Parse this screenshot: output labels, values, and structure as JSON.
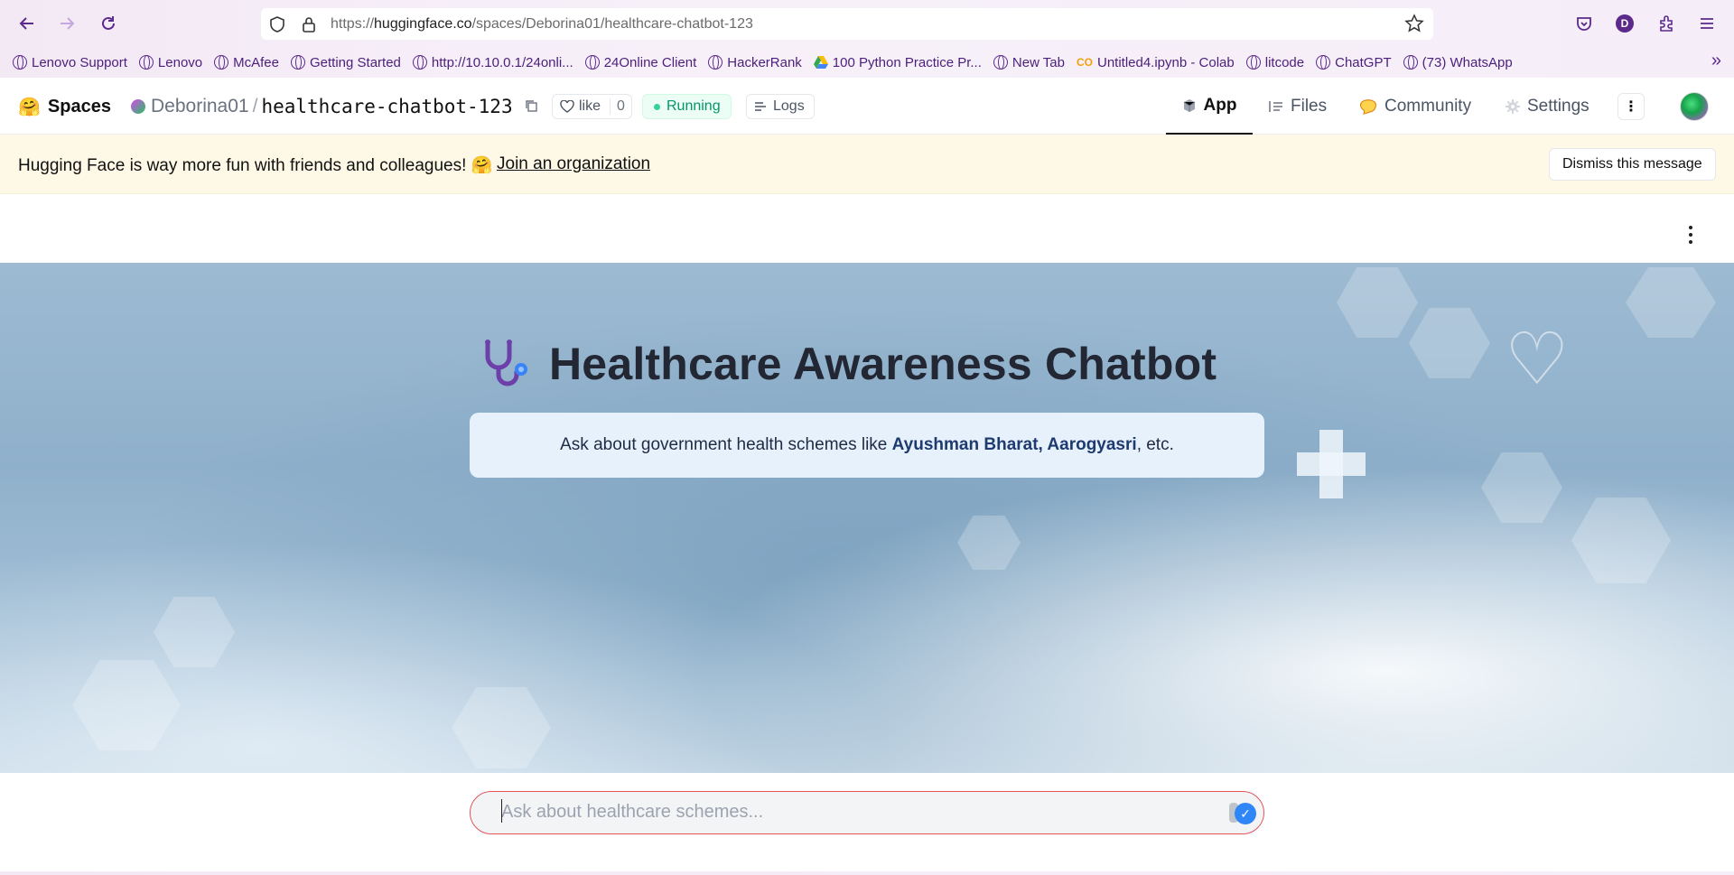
{
  "browser": {
    "url_prefix": "https://",
    "url_host": "huggingface.co",
    "url_path": "/spaces/Deborina01/healthcare-chatbot-123",
    "profile_initial": "D",
    "bookmarks": [
      {
        "label": "Lenovo Support",
        "icon": "globe-icon"
      },
      {
        "label": "Lenovo",
        "icon": "globe-icon"
      },
      {
        "label": "McAfee",
        "icon": "globe-icon"
      },
      {
        "label": "Getting Started",
        "icon": "globe-icon"
      },
      {
        "label": "http://10.10.0.1/24onli...",
        "icon": "globe-icon"
      },
      {
        "label": "24Online Client",
        "icon": "globe-icon"
      },
      {
        "label": "HackerRank",
        "icon": "globe-icon"
      },
      {
        "label": "100 Python Practice Pr...",
        "icon": "drive-icon"
      },
      {
        "label": "New Tab",
        "icon": "globe-icon"
      },
      {
        "label": "Untitled4.ipynb - Colab",
        "icon": "colab-icon"
      },
      {
        "label": "litcode",
        "icon": "globe-icon"
      },
      {
        "label": "ChatGPT",
        "icon": "globe-icon"
      },
      {
        "label": "(73) WhatsApp",
        "icon": "globe-icon"
      }
    ]
  },
  "hf": {
    "spaces_label": "Spaces",
    "owner": "Deborina01",
    "separator": "/",
    "repo": "healthcare-chatbot-123",
    "like_label": "like",
    "like_count": "0",
    "status": "Running",
    "logs_label": "Logs",
    "tabs": [
      {
        "label": "App",
        "icon": "cube-icon",
        "active": true
      },
      {
        "label": "Files",
        "icon": "files-icon",
        "active": false
      },
      {
        "label": "Community",
        "icon": "community-icon",
        "active": false
      },
      {
        "label": "Settings",
        "icon": "gear-icon",
        "active": false
      }
    ]
  },
  "banner": {
    "message": "Hugging Face is way more fun with friends and colleagues! 🤗",
    "link": "Join an organization",
    "dismiss": "Dismiss this message"
  },
  "app": {
    "title": "Healthcare Awareness Chatbot",
    "subtitle_pre": "Ask about government health schemes like ",
    "scheme_1": "Ayushman Bharat",
    "comma": ", ",
    "scheme_2": "Aarogyasri",
    "subtitle_post": ", etc.",
    "input_placeholder": "Ask about healthcare schemes..."
  },
  "colors": {
    "accent_purple": "#5b2a8a",
    "running_green": "#059669",
    "input_border": "#e2545a",
    "send_blue": "#2f86f6"
  }
}
